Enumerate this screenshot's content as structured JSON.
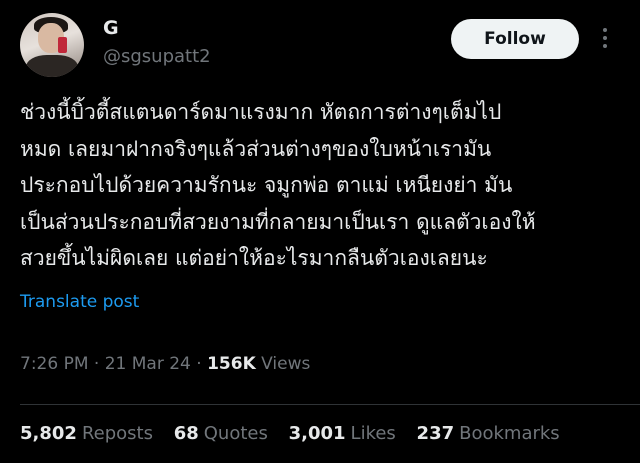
{
  "author": {
    "name": "G",
    "handle": "@sgsupatt2"
  },
  "follow_label": "Follow",
  "post": {
    "lines": [
      "ช่วงนี้บิ้วตี้สแตนดาร์ดมาแรงมาก หัตถการต่างๆเต็มไป",
      "หมด เลยมาฝากจริงๆแล้วส่วนต่างๆของใบหน้าเรามัน",
      "ประกอบไปด้วยความรักนะ จมูกพ่อ ตาแม่ เหนียงย่า มัน",
      "เป็นส่วนประกอบที่สวยงามที่กลายมาเป็นเรา ดูแลตัวเองให้",
      "สวยขึ้นไม่ผิดเลย แต่อย่าให้อะไรมากลืนตัวเองเลยนะ"
    ]
  },
  "translate_label": "Translate post",
  "meta": {
    "time": "7:26 PM",
    "date": "21 Mar 24",
    "views_count": "156K",
    "views_label": "Views"
  },
  "stats": {
    "reposts_count": "5,802",
    "reposts_label": "Reposts",
    "quotes_count": "68",
    "quotes_label": "Quotes",
    "likes_count": "3,001",
    "likes_label": "Likes",
    "bookmarks_count": "237",
    "bookmarks_label": "Bookmarks"
  },
  "colors": {
    "background": "#000000",
    "text": "#e7e9ea",
    "secondary": "#71767b",
    "link": "#1d9bf0",
    "button_bg": "#eff3f4"
  }
}
